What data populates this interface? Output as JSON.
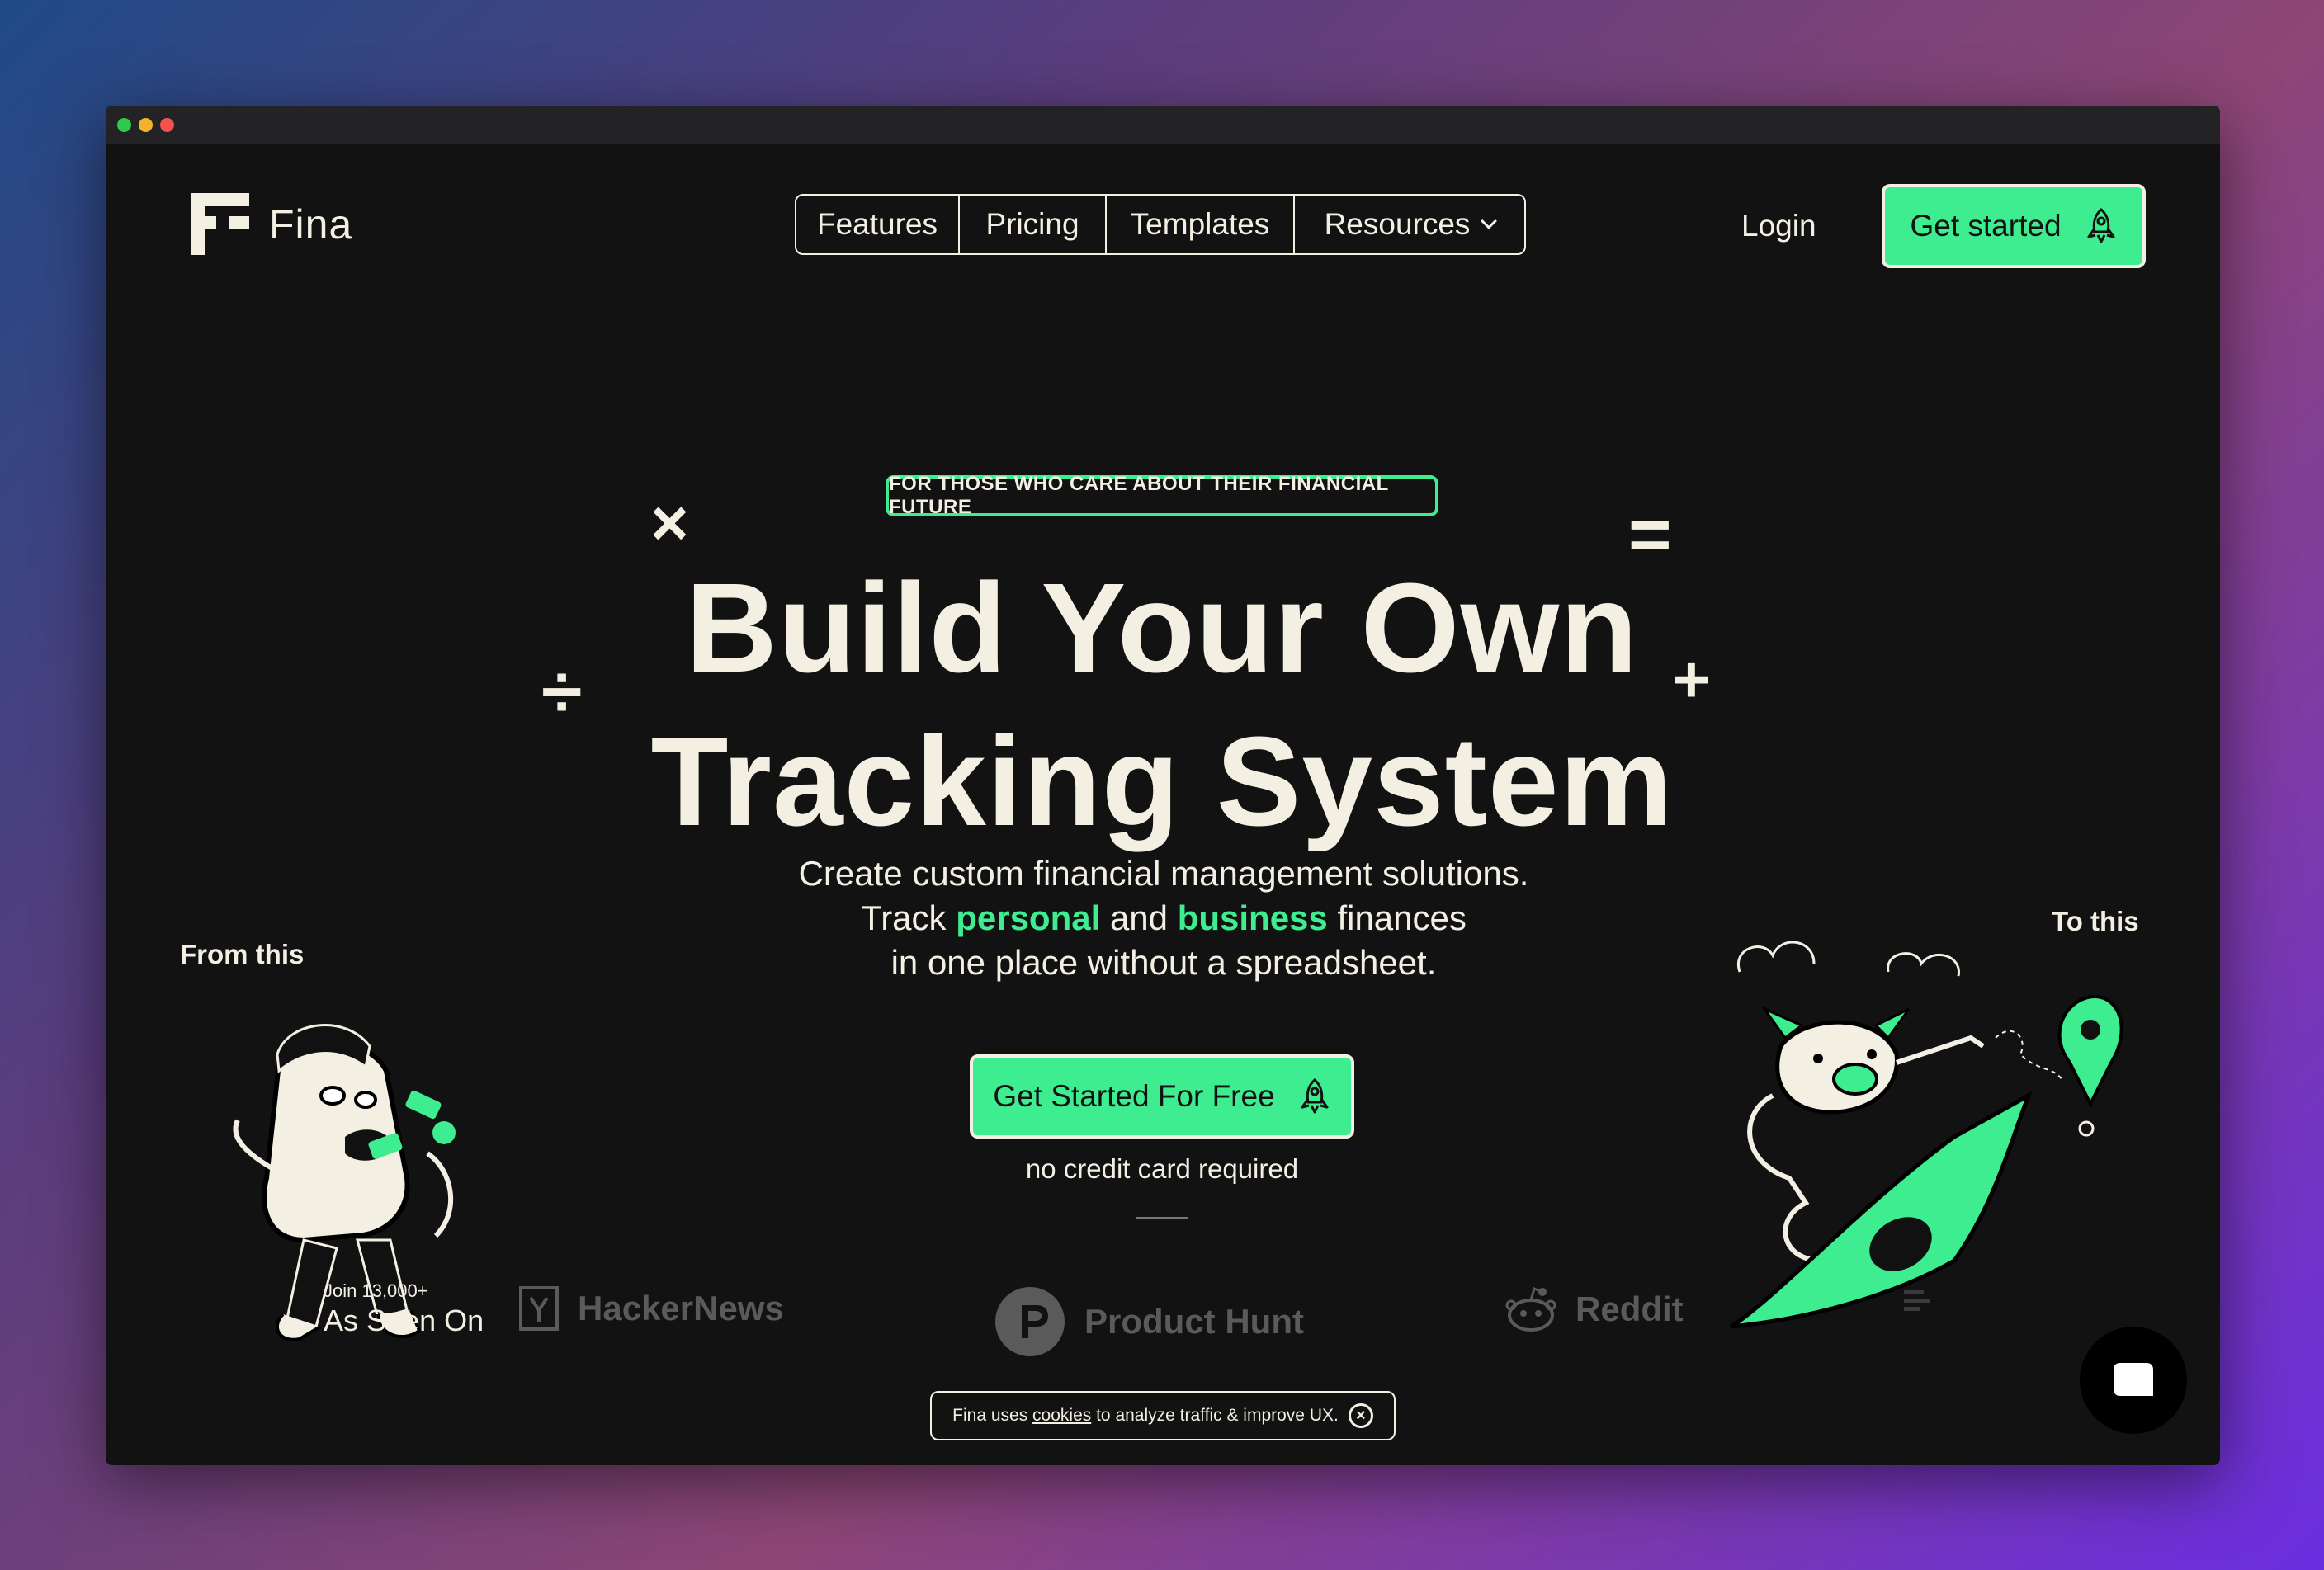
{
  "window": {
    "controls": [
      "close",
      "minimize",
      "zoom"
    ]
  },
  "brand": {
    "name": "Fina",
    "accent": "#3ded8f",
    "text_color": "#f3efe3",
    "background": "#111211"
  },
  "nav": {
    "items": [
      {
        "label": "Features"
      },
      {
        "label": "Pricing"
      },
      {
        "label": "Templates"
      },
      {
        "label": "Resources",
        "has_dropdown": true
      }
    ],
    "login": "Login",
    "get_started": "Get started"
  },
  "hero": {
    "badge": "FOR THOSE WHO CARE ABOUT THEIR FINANCIAL FUTURE",
    "headline_line1": "Build Your Own",
    "headline_line2": "Tracking System",
    "subtext_line1": "Create custom financial management solutions.",
    "subtext_track": "Track",
    "subtext_personal": "personal",
    "subtext_and": "and",
    "subtext_business": "business",
    "subtext_finances": "finances",
    "subtext_line3": "in one place without a spreadsheet.",
    "cta": "Get Started For Free",
    "cta_note": "no credit card required",
    "symbols": [
      "×",
      "=",
      "÷",
      "+"
    ]
  },
  "illustrations": {
    "left_caption": "From this",
    "right_caption": "To this"
  },
  "social_proof": {
    "join": "Join 13,000+",
    "as_seen_on": "As Seen On",
    "logos": [
      "HackerNews",
      "Product Hunt",
      "Reddit"
    ]
  },
  "cookie_banner": {
    "prefix": "Fina uses",
    "link": "cookies",
    "suffix": "to analyze traffic & improve UX."
  }
}
